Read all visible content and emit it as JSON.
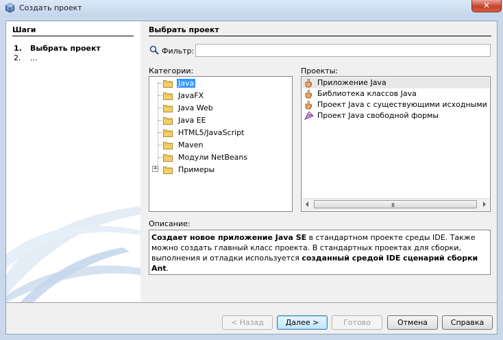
{
  "window": {
    "title": "Создать проект",
    "close_label": "✕"
  },
  "steps": {
    "title": "Шаги",
    "items": [
      {
        "num": "1.",
        "label": "Выбрать проект"
      },
      {
        "num": "2.",
        "label": "..."
      }
    ]
  },
  "content": {
    "title": "Выбрать проект",
    "filter_label": "Фильтр:",
    "filter_value": "",
    "categories_label": "Категории:",
    "projects_label": "Проекты:",
    "categories": [
      "Java",
      "JavaFX",
      "Java Web",
      "Java EE",
      "HTML5/JavaScript",
      "Maven",
      "Модули NetBeans",
      "Примеры"
    ],
    "selected_category": "Java",
    "projects": [
      "Приложение Java",
      "Библиотека классов Java",
      "Проект Java с существующими исходными файла",
      "Проект Java свободной формы"
    ],
    "description_label": "Описание:",
    "description": {
      "p1_bold": "Создает новое приложение Java SE",
      "p1_rest": " в стандартном проекте среды IDE. Также можно создать главный класс проекта. В стандартных проектах для сборки, выполнения и отладки используется ",
      "p2_bold": "созданный средой IDE сценарий сборки Ant",
      "p2_rest": "."
    }
  },
  "buttons": {
    "back": "< Назад",
    "next": "Далее >",
    "finish": "Готово",
    "cancel": "Отмена",
    "help": "Справка"
  },
  "colors": {
    "selection": "#3399ff",
    "title_bar": "#c4d6ec",
    "close": "#c7402c"
  }
}
